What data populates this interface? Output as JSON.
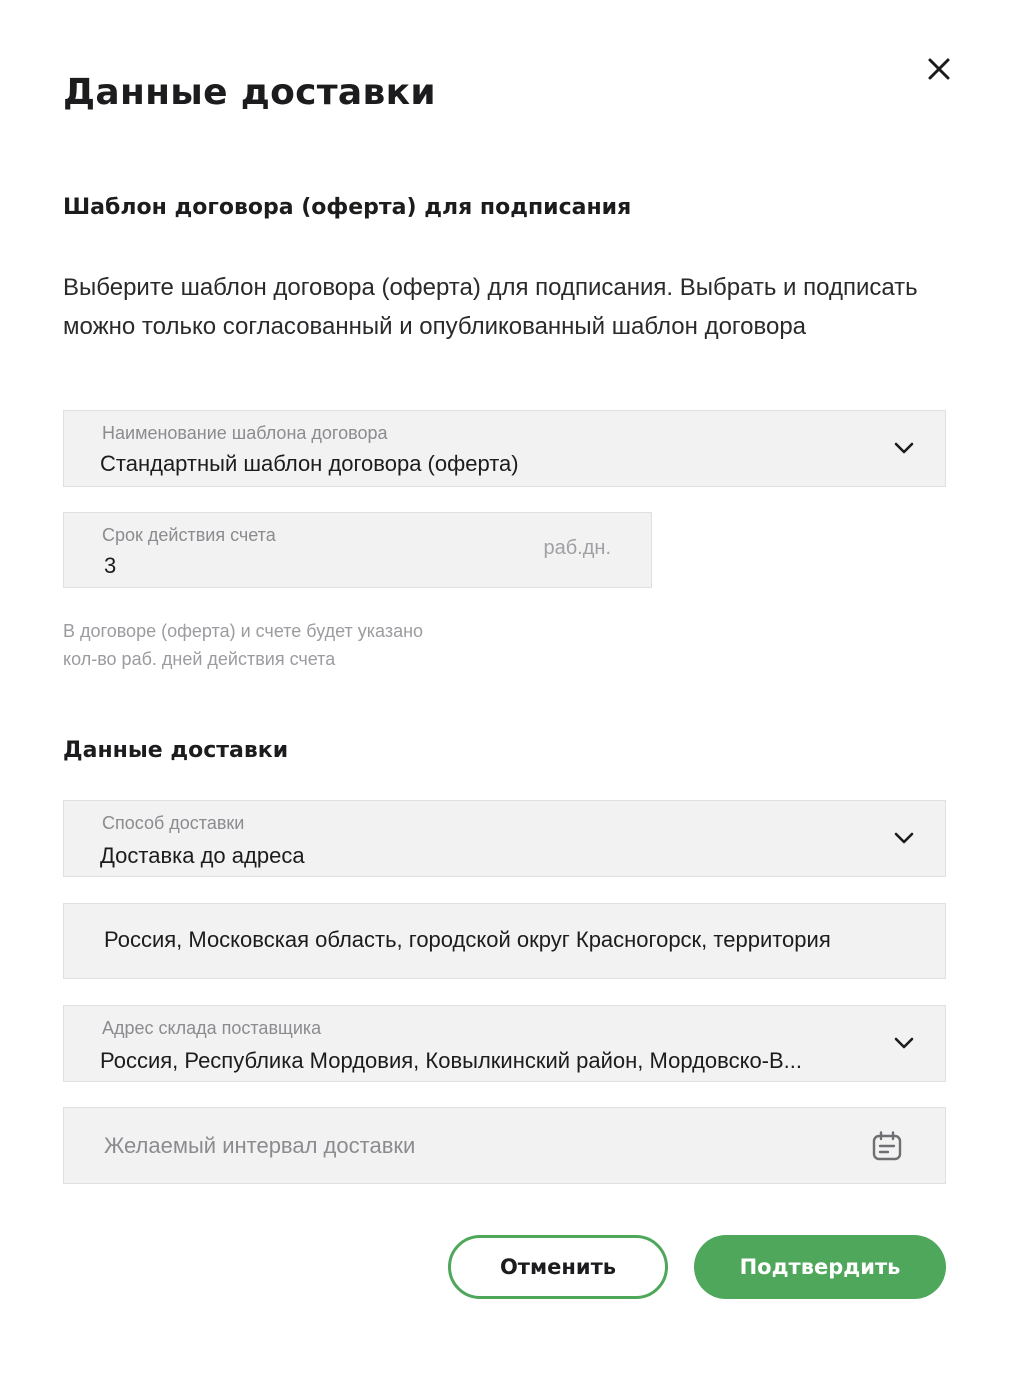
{
  "header": {
    "title": "Данные доставки"
  },
  "contract": {
    "section_title": "Шаблон договора (оферта) для подписания",
    "description": "Выберите шаблон договора (оферта) для подписания. Выбрать и подписать можно только согласованный и опубликованный шаблон договора",
    "template_select": {
      "label": "Наименование шаблона договора",
      "value": "Стандартный шаблон договора (оферта)"
    },
    "invoice_term": {
      "label": "Срок действия счета",
      "value": "3",
      "suffix": "раб.дн."
    },
    "hint_line1": "В договоре (оферта) и счете будет указано",
    "hint_line2": "кол-во раб. дней действия счета"
  },
  "delivery": {
    "section_title": "Данные доставки",
    "method_select": {
      "label": "Способ доставки",
      "value": "Доставка до адреса"
    },
    "address_value": "Россия, Московская область, городской округ Красногорск, территория",
    "warehouse_select": {
      "label": "Адрес склада поставщика",
      "value": "Россия, Республика Мордовия, Ковылкинский район, Мордовско-В..."
    },
    "interval_placeholder": "Желаемый интервал доставки"
  },
  "footer": {
    "cancel_label": "Отменить",
    "confirm_label": "Подтвердить"
  },
  "icons": {
    "close": "close-icon",
    "chevron": "chevron-down-icon",
    "calendar": "calendar-icon"
  },
  "colors": {
    "accent": "#4ea75b",
    "field_bg": "#f2f2f2",
    "text": "#1c1c1e",
    "muted": "#8b8b90"
  }
}
